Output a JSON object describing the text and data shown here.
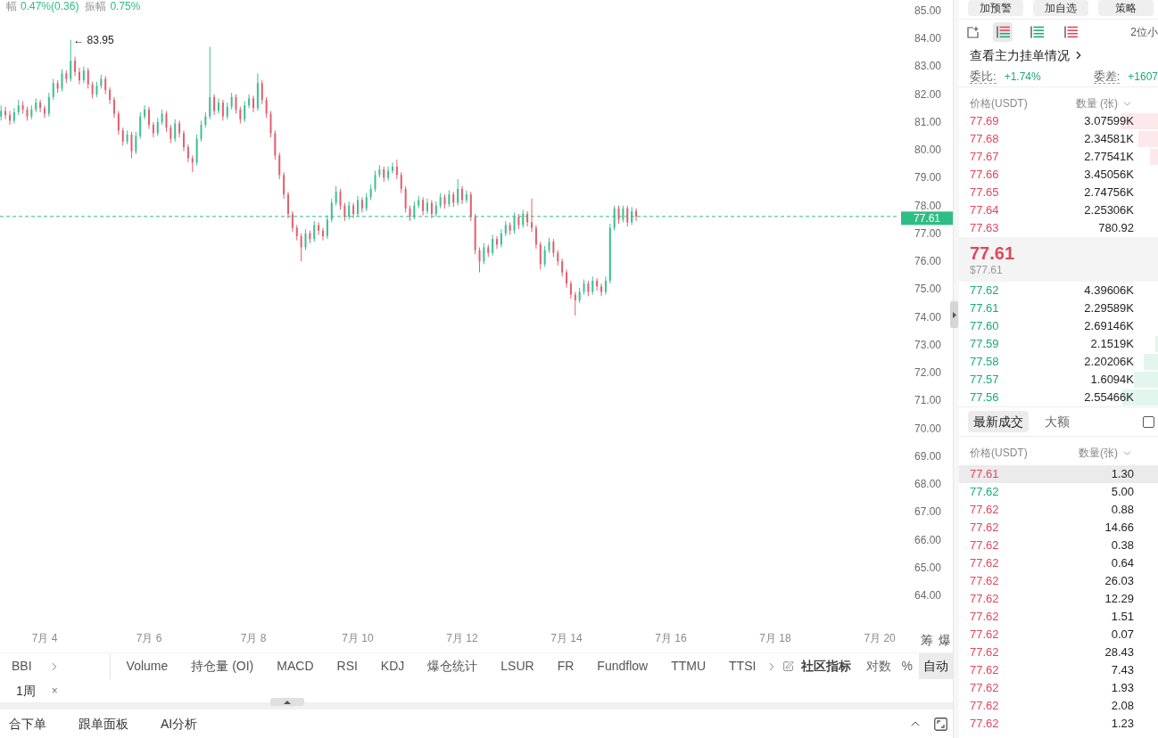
{
  "ticker_stats": [
    {
      "label": "幅",
      "value": "0.47%(0.36)"
    },
    {
      "label": "振幅",
      "value": "0.75%"
    }
  ],
  "chart": {
    "chart_data": [
      {
        "type": "candlestick",
        "x": [
          "--07-03T04:00",
          "--07-03T06:00",
          "--07-03T08:00",
          "--07-03T10:00",
          "--07-03T12:00",
          "--07-03T14:00",
          "--07-03T16:00",
          "--07-03T18:00",
          "--07-03T20:00",
          "--07-03T22:00",
          "--07-04T00:00",
          "--07-04T02:00",
          "--07-04T04:00",
          "--07-04T06:00",
          "--07-04T08:00",
          "--07-04T10:00",
          "--07-04T12:00",
          "--07-04T14:00",
          "--07-04T16:00",
          "--07-04T18:00",
          "--07-04T20:00",
          "--07-04T22:00",
          "--07-05T00:00",
          "--07-05T02:00",
          "--07-05T04:00",
          "--07-05T06:00",
          "--07-05T08:00",
          "--07-05T10:00",
          "--07-05T12:00",
          "--07-05T14:00",
          "--07-05T16:00",
          "--07-05T18:00",
          "--07-05T20:00",
          "--07-05T22:00",
          "--07-06T00:00",
          "--07-06T02:00",
          "--07-06T04:00",
          "--07-06T06:00",
          "--07-06T08:00",
          "--07-06T10:00",
          "--07-06T12:00",
          "--07-06T14:00",
          "--07-06T16:00",
          "--07-06T18:00",
          "--07-06T20:00",
          "--07-06T22:00",
          "--07-07T00:00",
          "--07-07T02:00",
          "--07-07T04:00",
          "--07-07T06:00",
          "--07-07T08:00",
          "--07-07T10:00",
          "--07-07T12:00",
          "--07-07T14:00",
          "--07-07T16:00",
          "--07-07T18:00",
          "--07-07T20:00",
          "--07-07T22:00",
          "--07-08T00:00",
          "--07-08T02:00",
          "--07-08T04:00",
          "--07-08T06:00",
          "--07-08T08:00",
          "--07-08T10:00",
          "--07-08T12:00",
          "--07-08T14:00",
          "--07-08T16:00",
          "--07-08T18:00",
          "--07-08T20:00",
          "--07-08T22:00",
          "--07-09T00:00",
          "--07-09T02:00",
          "--07-09T04:00",
          "--07-09T06:00",
          "--07-09T08:00",
          "--07-09T10:00",
          "--07-09T12:00",
          "--07-09T14:00",
          "--07-09T16:00",
          "--07-09T18:00",
          "--07-09T20:00",
          "--07-09T22:00",
          "--07-10T00:00",
          "--07-10T02:00",
          "--07-10T04:00",
          "--07-10T06:00",
          "--07-10T08:00",
          "--07-10T10:00",
          "--07-10T12:00",
          "--07-10T14:00",
          "--07-10T16:00",
          "--07-10T18:00",
          "--07-10T20:00",
          "--07-10T22:00",
          "--07-11T00:00",
          "--07-11T02:00",
          "--07-11T04:00",
          "--07-11T06:00",
          "--07-11T08:00",
          "--07-11T10:00",
          "--07-11T12:00",
          "--07-11T14:00",
          "--07-11T16:00",
          "--07-11T18:00",
          "--07-11T20:00",
          "--07-11T22:00",
          "--07-12T00:00",
          "--07-12T02:00",
          "--07-12T04:00",
          "--07-12T06:00",
          "--07-12T08:00",
          "--07-12T10:00",
          "--07-12T12:00",
          "--07-12T14:00",
          "--07-12T16:00",
          "--07-12T18:00",
          "--07-12T20:00",
          "--07-12T22:00",
          "--07-13T00:00",
          "--07-13T02:00",
          "--07-13T04:00",
          "--07-13T06:00",
          "--07-13T08:00",
          "--07-13T10:00",
          "--07-13T12:00",
          "--07-13T14:00",
          "--07-13T16:00",
          "--07-13T18:00",
          "--07-13T20:00",
          "--07-13T22:00",
          "--07-14T00:00",
          "--07-14T02:00",
          "--07-14T04:00",
          "--07-14T06:00",
          "--07-14T08:00",
          "--07-14T10:00",
          "--07-14T12:00",
          "--07-14T14:00",
          "--07-14T16:00",
          "--07-14T18:00",
          "--07-14T20:00",
          "--07-14T22:00",
          "--07-15T00:00",
          "--07-15T02:00",
          "--07-15T04:00",
          "--07-15T06:00",
          "--07-15T08:00"
        ],
        "ohlc": [
          [
            81.2,
            81.6,
            81.05,
            81.4
          ],
          [
            81.4,
            81.55,
            81.1,
            81.25
          ],
          [
            81.25,
            81.4,
            80.9,
            81.05
          ],
          [
            81.05,
            81.5,
            80.95,
            81.35
          ],
          [
            81.35,
            81.8,
            81.25,
            81.6
          ],
          [
            81.6,
            81.75,
            81.3,
            81.45
          ],
          [
            81.45,
            81.55,
            81.05,
            81.2
          ],
          [
            81.2,
            81.6,
            81.1,
            81.45
          ],
          [
            81.45,
            81.85,
            81.35,
            81.7
          ],
          [
            81.7,
            81.8,
            81.35,
            81.5
          ],
          [
            81.5,
            81.6,
            81.15,
            81.3
          ],
          [
            81.3,
            82.05,
            81.2,
            81.9
          ],
          [
            81.9,
            82.55,
            81.8,
            82.4
          ],
          [
            82.4,
            82.5,
            82.05,
            82.2
          ],
          [
            82.2,
            82.9,
            82.1,
            82.75
          ],
          [
            82.75,
            82.85,
            82.4,
            82.55
          ],
          [
            82.55,
            83.95,
            82.45,
            83.2
          ],
          [
            83.2,
            83.35,
            82.65,
            82.8
          ],
          [
            82.8,
            82.95,
            82.35,
            82.5
          ],
          [
            82.5,
            83.0,
            82.4,
            82.85
          ],
          [
            82.85,
            82.95,
            82.2,
            82.35
          ],
          [
            82.35,
            82.45,
            81.85,
            82.0
          ],
          [
            82.0,
            82.45,
            81.9,
            82.3
          ],
          [
            82.3,
            82.7,
            82.2,
            82.55
          ],
          [
            82.55,
            82.65,
            82.0,
            82.15
          ],
          [
            82.15,
            82.25,
            81.65,
            81.8
          ],
          [
            81.8,
            81.9,
            81.15,
            81.3
          ],
          [
            81.3,
            81.4,
            80.55,
            80.7
          ],
          [
            80.7,
            80.8,
            80.15,
            80.3
          ],
          [
            80.3,
            80.7,
            80.2,
            80.55
          ],
          [
            80.55,
            80.65,
            79.7,
            79.95
          ],
          [
            79.95,
            80.65,
            79.85,
            80.5
          ],
          [
            80.5,
            81.35,
            80.4,
            81.2
          ],
          [
            81.2,
            81.6,
            81.1,
            81.45
          ],
          [
            81.45,
            81.55,
            80.75,
            80.9
          ],
          [
            80.9,
            81.0,
            80.45,
            80.6
          ],
          [
            80.6,
            81.15,
            80.5,
            81.0
          ],
          [
            81.0,
            81.45,
            80.9,
            81.3
          ],
          [
            81.3,
            81.4,
            80.65,
            80.8
          ],
          [
            80.8,
            80.9,
            80.25,
            80.4
          ],
          [
            80.4,
            81.1,
            80.3,
            80.95
          ],
          [
            80.95,
            81.05,
            80.45,
            80.6
          ],
          [
            80.6,
            80.7,
            79.95,
            80.1
          ],
          [
            80.1,
            80.2,
            79.55,
            79.7
          ],
          [
            79.7,
            79.8,
            79.2,
            79.55
          ],
          [
            79.55,
            80.55,
            79.45,
            80.4
          ],
          [
            80.4,
            81.05,
            80.3,
            80.9
          ],
          [
            80.9,
            81.35,
            80.8,
            81.2
          ],
          [
            81.2,
            83.7,
            81.1,
            81.9
          ],
          [
            81.9,
            82.0,
            81.25,
            81.4
          ],
          [
            81.4,
            81.85,
            81.3,
            81.7
          ],
          [
            81.7,
            81.8,
            81.05,
            81.2
          ],
          [
            81.2,
            81.7,
            81.1,
            81.55
          ],
          [
            81.55,
            82.05,
            81.45,
            81.9
          ],
          [
            81.9,
            82.0,
            81.3,
            81.45
          ],
          [
            81.45,
            81.55,
            80.95,
            81.1
          ],
          [
            81.1,
            81.75,
            81.0,
            81.6
          ],
          [
            81.6,
            82.0,
            81.5,
            81.85
          ],
          [
            81.85,
            81.95,
            81.35,
            81.5
          ],
          [
            81.5,
            82.75,
            81.4,
            82.4
          ],
          [
            82.4,
            82.5,
            81.65,
            81.8
          ],
          [
            81.8,
            81.9,
            81.15,
            81.3
          ],
          [
            81.3,
            81.4,
            80.45,
            80.6
          ],
          [
            80.6,
            80.7,
            79.65,
            79.8
          ],
          [
            79.8,
            79.9,
            78.95,
            79.1
          ],
          [
            79.1,
            79.2,
            78.25,
            78.4
          ],
          [
            78.4,
            78.5,
            77.55,
            77.7
          ],
          [
            77.7,
            77.8,
            77.05,
            77.2
          ],
          [
            77.2,
            77.3,
            76.75,
            76.9
          ],
          [
            76.9,
            77.0,
            76.0,
            76.5
          ],
          [
            76.5,
            77.15,
            76.4,
            77.0
          ],
          [
            77.0,
            77.1,
            76.65,
            76.8
          ],
          [
            76.8,
            77.45,
            76.7,
            77.3
          ],
          [
            77.3,
            77.4,
            76.95,
            77.1
          ],
          [
            77.1,
            77.2,
            76.75,
            76.9
          ],
          [
            76.9,
            77.65,
            76.8,
            77.5
          ],
          [
            77.5,
            78.25,
            77.4,
            78.1
          ],
          [
            78.1,
            78.7,
            78.0,
            78.5
          ],
          [
            78.5,
            78.6,
            77.85,
            78.0
          ],
          [
            78.0,
            78.1,
            77.45,
            77.6
          ],
          [
            77.6,
            78.15,
            77.5,
            78.0
          ],
          [
            78.0,
            78.1,
            77.55,
            77.7
          ],
          [
            77.7,
            78.35,
            77.6,
            78.2
          ],
          [
            78.2,
            78.3,
            77.75,
            77.9
          ],
          [
            77.9,
            78.45,
            77.8,
            78.3
          ],
          [
            78.3,
            78.75,
            78.2,
            78.6
          ],
          [
            78.6,
            79.25,
            78.5,
            79.1
          ],
          [
            79.1,
            79.45,
            79.0,
            79.3
          ],
          [
            79.3,
            79.4,
            78.85,
            79.0
          ],
          [
            79.0,
            79.4,
            78.9,
            79.25
          ],
          [
            79.25,
            79.55,
            79.15,
            79.4
          ],
          [
            79.4,
            79.65,
            78.95,
            79.1
          ],
          [
            79.1,
            79.2,
            78.45,
            78.6
          ],
          [
            78.6,
            78.7,
            77.75,
            77.9
          ],
          [
            77.9,
            78.0,
            77.45,
            77.6
          ],
          [
            77.6,
            78.15,
            77.5,
            78.0
          ],
          [
            78.0,
            78.35,
            77.9,
            78.2
          ],
          [
            78.2,
            78.3,
            77.65,
            77.8
          ],
          [
            77.8,
            78.25,
            77.7,
            78.1
          ],
          [
            78.1,
            78.2,
            77.55,
            77.7
          ],
          [
            77.7,
            78.15,
            77.6,
            78.0
          ],
          [
            78.0,
            78.45,
            77.9,
            78.3
          ],
          [
            78.3,
            78.4,
            77.9,
            78.05
          ],
          [
            78.05,
            78.55,
            77.95,
            78.4
          ],
          [
            78.4,
            78.5,
            77.95,
            78.1
          ],
          [
            78.1,
            78.95,
            78.0,
            78.6
          ],
          [
            78.6,
            78.7,
            78.05,
            78.2
          ],
          [
            78.2,
            78.55,
            78.1,
            78.4
          ],
          [
            78.4,
            78.5,
            77.45,
            77.6
          ],
          [
            77.6,
            77.7,
            76.25,
            76.4
          ],
          [
            76.4,
            76.5,
            75.6,
            76.0
          ],
          [
            76.0,
            76.65,
            75.9,
            76.5
          ],
          [
            76.5,
            76.6,
            76.15,
            76.3
          ],
          [
            76.3,
            76.95,
            76.2,
            76.8
          ],
          [
            76.8,
            76.9,
            76.45,
            76.6
          ],
          [
            76.6,
            77.15,
            76.5,
            77.0
          ],
          [
            77.0,
            77.45,
            76.9,
            77.3
          ],
          [
            77.3,
            77.4,
            76.95,
            77.1
          ],
          [
            77.1,
            77.75,
            77.0,
            77.6
          ],
          [
            77.6,
            77.7,
            77.15,
            77.3
          ],
          [
            77.3,
            77.85,
            77.2,
            77.7
          ],
          [
            77.7,
            77.8,
            77.25,
            77.4
          ],
          [
            77.4,
            78.25,
            77.05,
            77.2
          ],
          [
            77.2,
            77.3,
            76.45,
            76.6
          ],
          [
            76.6,
            76.7,
            75.7,
            75.9
          ],
          [
            75.9,
            76.55,
            75.8,
            76.4
          ],
          [
            76.4,
            76.85,
            76.3,
            76.7
          ],
          [
            76.7,
            76.8,
            76.15,
            76.3
          ],
          [
            76.3,
            76.4,
            75.85,
            76.0
          ],
          [
            76.0,
            76.1,
            75.45,
            75.6
          ],
          [
            75.6,
            75.7,
            75.05,
            75.2
          ],
          [
            75.2,
            75.3,
            74.65,
            74.8
          ],
          [
            74.8,
            74.9,
            74.05,
            74.6
          ],
          [
            74.6,
            75.05,
            74.5,
            74.9
          ],
          [
            74.9,
            75.35,
            74.8,
            75.2
          ],
          [
            75.2,
            75.3,
            74.75,
            74.9
          ],
          [
            74.9,
            75.45,
            74.8,
            75.3
          ],
          [
            75.3,
            75.4,
            74.95,
            75.1
          ],
          [
            75.1,
            75.2,
            74.75,
            74.9
          ],
          [
            74.9,
            75.45,
            74.8,
            75.3
          ],
          [
            75.3,
            77.35,
            75.2,
            77.2
          ],
          [
            77.2,
            78.0,
            77.1,
            77.9
          ],
          [
            77.9,
            78.0,
            77.35,
            77.5
          ],
          [
            77.5,
            78.0,
            77.4,
            77.9
          ],
          [
            77.9,
            78.0,
            77.25,
            77.4
          ],
          [
            77.4,
            77.95,
            77.3,
            77.8
          ],
          [
            77.8,
            77.9,
            77.45,
            77.61
          ]
        ],
        "xlim": [
          "--07-03T03:30",
          "--07-20T09:00"
        ],
        "ylim": [
          64,
          85
        ],
        "xticks": [
          {
            "value": "--07-04",
            "label": "7月 4"
          },
          {
            "value": "--07-06",
            "label": "7月 6"
          },
          {
            "value": "--07-08",
            "label": "7月 8"
          },
          {
            "value": "--07-10",
            "label": "7月 10"
          },
          {
            "value": "--07-12",
            "label": "7月 12"
          },
          {
            "value": "--07-14",
            "label": "7月 14"
          },
          {
            "value": "--07-16",
            "label": "7月 16"
          },
          {
            "value": "--07-18",
            "label": "7月 18"
          },
          {
            "value": "--07-20",
            "label": "7月 20"
          }
        ],
        "yticks": [
          {
            "value": 85,
            "label": "85.00"
          },
          {
            "value": 84,
            "label": "84.00"
          },
          {
            "value": 83,
            "label": "83.00"
          },
          {
            "value": 82,
            "label": "82.00"
          },
          {
            "value": 81,
            "label": "81.00"
          },
          {
            "value": 80,
            "label": "80.00"
          },
          {
            "value": 79,
            "label": "79.00"
          },
          {
            "value": 78,
            "label": "78.00"
          },
          {
            "value": 77,
            "label": "77.00"
          },
          {
            "value": 76,
            "label": "76.00"
          },
          {
            "value": 75,
            "label": "75.00"
          },
          {
            "value": 74,
            "label": "74.00"
          },
          {
            "value": 73,
            "label": "73.00"
          },
          {
            "value": 72,
            "label": "72.00"
          },
          {
            "value": 71,
            "label": "71.00"
          },
          {
            "value": 70,
            "label": "70.00"
          },
          {
            "value": 69,
            "label": "69.00"
          },
          {
            "value": 68,
            "label": "68.00"
          },
          {
            "value": 67,
            "label": "67.00"
          },
          {
            "value": 66,
            "label": "66.00"
          },
          {
            "value": 65,
            "label": "65.00"
          },
          {
            "value": 64,
            "label": "64.00"
          }
        ],
        "ref_lines": [
          {
            "axis": "y",
            "value": 77.61,
            "label": "77.61",
            "color": "#2ebd85",
            "line_style": "dashed"
          }
        ],
        "annotations": [
          "← 83.95"
        ]
      }
    ],
    "axis_buttons": [
      "筹",
      "爆"
    ]
  },
  "indicator_bar": {
    "main": "BBI",
    "indicators": [
      "Volume",
      "持仓量 (OI)",
      "MACD",
      "RSI",
      "KDJ",
      "爆仓统计",
      "LSUR",
      "FR",
      "Fundflow",
      "TTMU",
      "TTSI"
    ],
    "community": "社区指标",
    "scale_options": [
      {
        "label": "对数",
        "selected": false
      },
      {
        "label": "%",
        "selected": false
      },
      {
        "label": "自动",
        "selected": true
      }
    ]
  },
  "interval_tag": {
    "label": "1周",
    "close": "×"
  },
  "bottom_panel": {
    "tabs": [
      "合下单",
      "跟单面板",
      "AI分析"
    ]
  },
  "order_panel": {
    "actions": [
      "加预警",
      "加自选",
      "策略"
    ],
    "views": [
      {
        "kind": "both",
        "selected": true
      },
      {
        "kind": "bids",
        "selected": false
      },
      {
        "kind": "asks",
        "selected": false
      }
    ],
    "precision": "2位小",
    "main_orders_link": "查看主力挂单情况",
    "ratio": {
      "label": "委比:",
      "value": "+1.74%"
    },
    "delta": {
      "label": "委差:",
      "value": "+1607"
    },
    "book_columns": [
      "价格(USDT)",
      "数量 (张)"
    ],
    "asks": [
      {
        "price": "77.69",
        "amount": "3.07599K",
        "level": 0.19
      },
      {
        "price": "77.68",
        "amount": "2.34581K",
        "level": 0.1
      },
      {
        "price": "77.67",
        "amount": "2.77541K",
        "level": 0.04
      },
      {
        "price": "77.66",
        "amount": "3.45056K"
      },
      {
        "price": "77.65",
        "amount": "2.74756K"
      },
      {
        "price": "77.64",
        "amount": "2.25306K"
      },
      {
        "price": "77.63",
        "amount": "780.92"
      }
    ],
    "mid": {
      "price": "77.61",
      "usd": "$77.61",
      "falling": true
    },
    "bids": [
      {
        "price": "77.62",
        "amount": "4.39606K"
      },
      {
        "price": "77.61",
        "amount": "2.29589K"
      },
      {
        "price": "77.60",
        "amount": "2.69146K"
      },
      {
        "price": "77.59",
        "amount": "2.1519K",
        "level": 0.015
      },
      {
        "price": "77.58",
        "amount": "2.20206K",
        "level": 0.07
      },
      {
        "price": "77.57",
        "amount": "1.6094K",
        "level": 0.12
      },
      {
        "price": "77.56",
        "amount": "2.55466K",
        "level": 0.18
      }
    ],
    "trade_tabs": [
      {
        "label": "最新成交",
        "selected": true
      },
      {
        "label": "大额",
        "selected": false
      }
    ],
    "large_only": {
      "checked": false
    },
    "trade_columns": [
      "价格(USDT)",
      "数量(张)"
    ],
    "trades": [
      {
        "price": "77.61",
        "amount": "1.30",
        "kind": "sell",
        "highlighted": true
      },
      {
        "price": "77.62",
        "amount": "5.00",
        "kind": "buy"
      },
      {
        "price": "77.62",
        "amount": "0.88",
        "kind": "sell"
      },
      {
        "price": "77.62",
        "amount": "14.66",
        "kind": "sell"
      },
      {
        "price": "77.62",
        "amount": "0.38",
        "kind": "sell"
      },
      {
        "price": "77.62",
        "amount": "0.64",
        "kind": "sell"
      },
      {
        "price": "77.62",
        "amount": "26.03",
        "kind": "sell"
      },
      {
        "price": "77.62",
        "amount": "12.29",
        "kind": "sell"
      },
      {
        "price": "77.62",
        "amount": "1.51",
        "kind": "sell"
      },
      {
        "price": "77.62",
        "amount": "0.07",
        "kind": "sell"
      },
      {
        "price": "77.62",
        "amount": "28.43",
        "kind": "sell"
      },
      {
        "price": "77.62",
        "amount": "7.43",
        "kind": "sell"
      },
      {
        "price": "77.62",
        "amount": "1.93",
        "kind": "sell"
      },
      {
        "price": "77.62",
        "amount": "2.08",
        "kind": "sell"
      },
      {
        "price": "77.62",
        "amount": "1.23",
        "kind": "sell"
      }
    ]
  }
}
